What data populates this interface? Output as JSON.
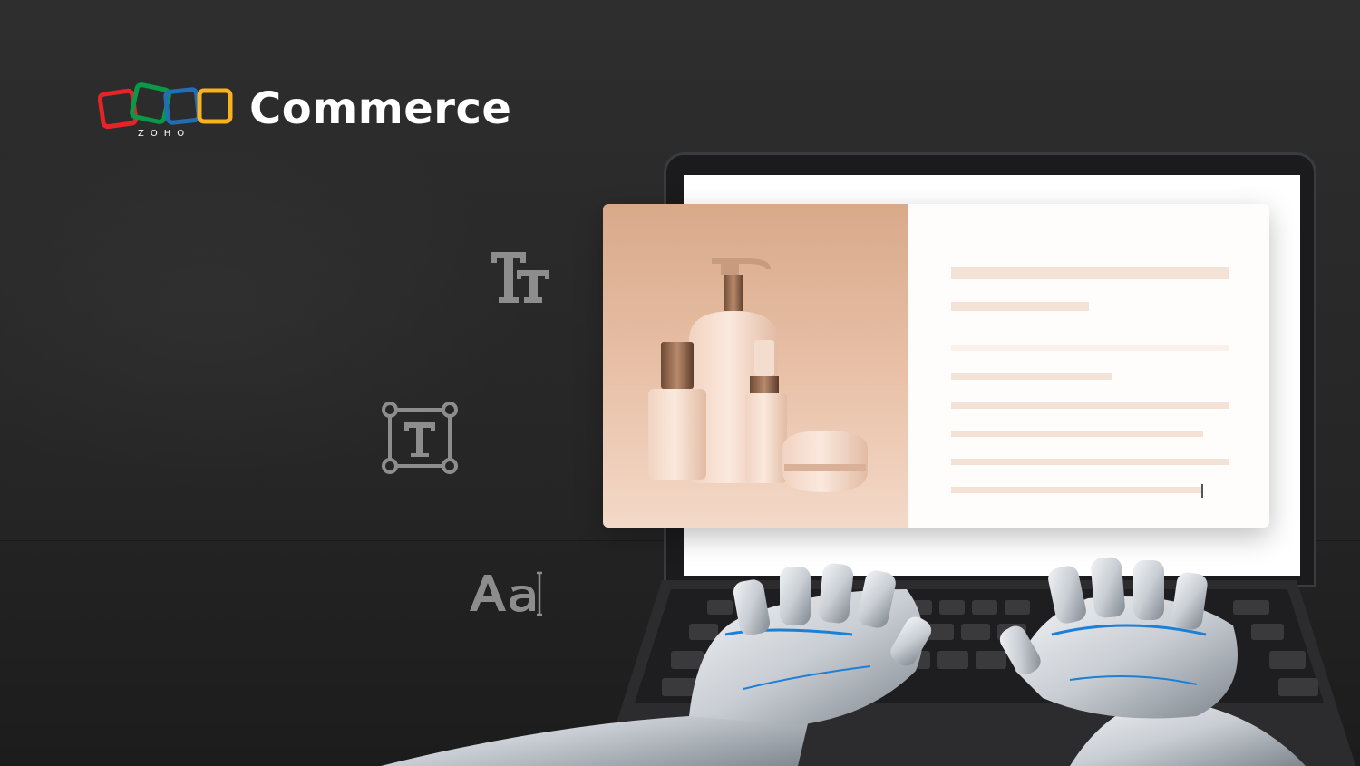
{
  "brand": {
    "wordmark": "Commerce",
    "subbrand": "ZOHO",
    "logo_colors": [
      "#e42527",
      "#089949",
      "#226db4",
      "#f9b21d"
    ]
  },
  "format_icons": {
    "text_size_label": "TT",
    "text_box_label": "T",
    "font_label": "Aa"
  },
  "colors": {
    "background": "#2a2a2a",
    "card_image_top": "#d9a98a",
    "text_placeholder": "#f5e2d7"
  }
}
